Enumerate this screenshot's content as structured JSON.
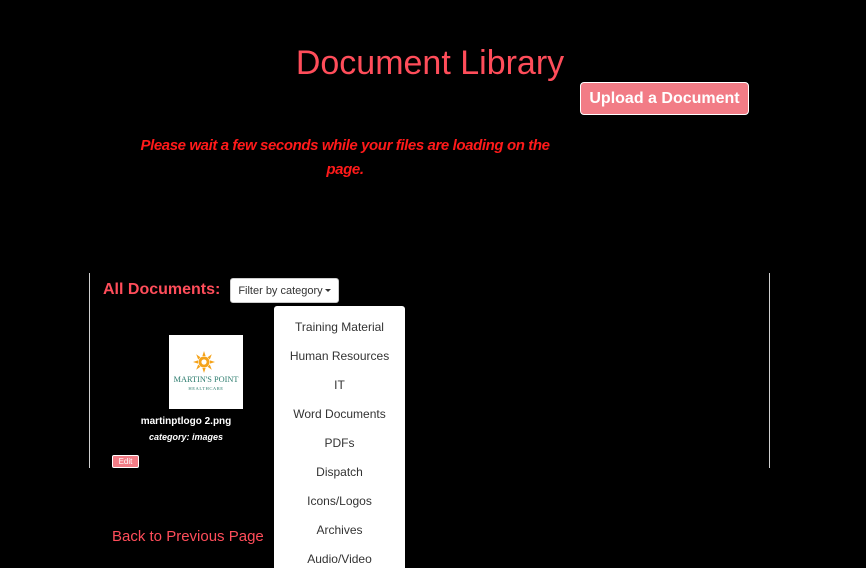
{
  "header": {
    "title": "Document Library",
    "upload_label": "Upload a Document"
  },
  "notice": {
    "loading_message": "Please wait a few seconds while your files are loading on the page."
  },
  "documents": {
    "heading": "All Documents:",
    "filter_label": "Filter by category",
    "filter_options": [
      "Training Material",
      "Human Resources",
      "IT",
      "Word Documents",
      "PDFs",
      "Dispatch",
      "Icons/Logos",
      "Archives",
      "Audio/Video"
    ],
    "items": [
      {
        "file_name": "martinptlogo 2.png",
        "category": "category: images",
        "edit_label": "Edit",
        "thumbnail": {
          "logo_main": "MARTIN'S POINT",
          "logo_sub": "HEALTHCARE"
        }
      }
    ]
  },
  "footer": {
    "back_label": "Back to Previous Page"
  },
  "colors": {
    "accent": "#ff4d5a",
    "button": "#f27c86",
    "warning": "#ff1a1a",
    "background": "#000000",
    "logo_teal": "#2e7d6f",
    "logo_sun": "#f5a31a"
  }
}
